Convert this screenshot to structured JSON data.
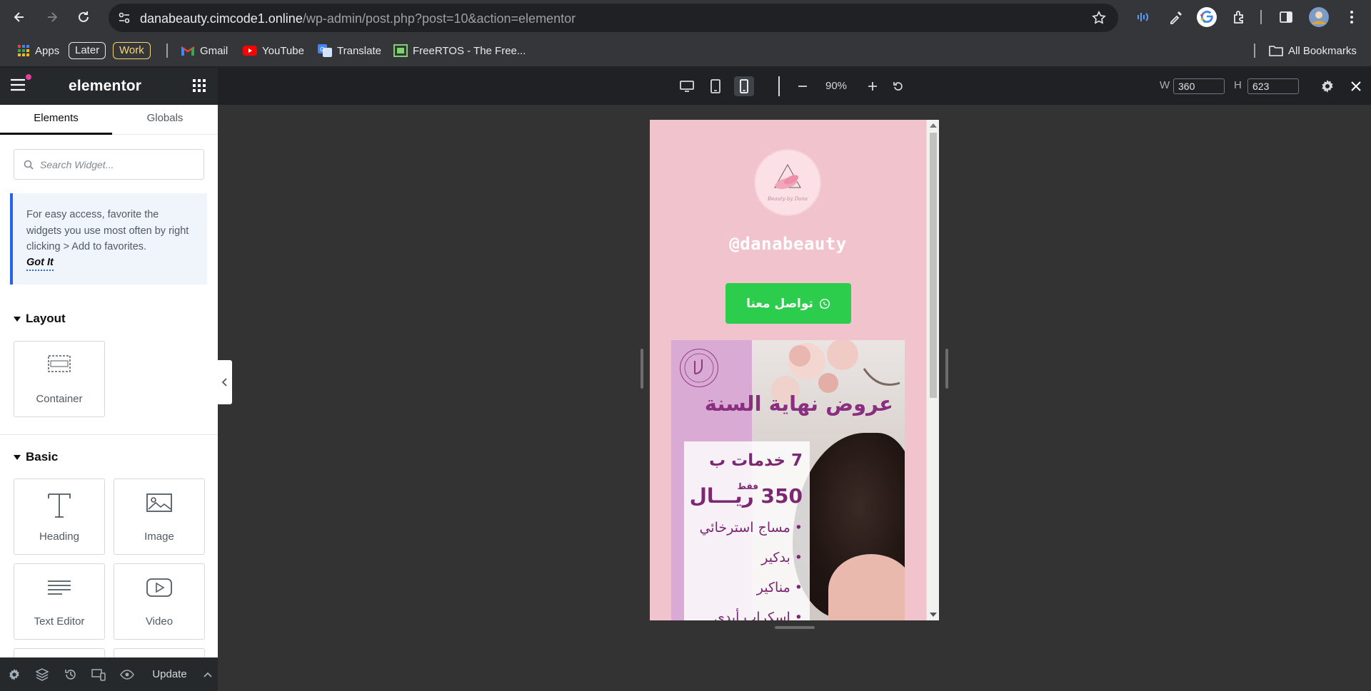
{
  "browser": {
    "url_host": "danabeauty.cimcode1.online",
    "url_path": "/wp-admin/post.php?post=10&action=elementor",
    "bookmarks": {
      "apps": "Apps",
      "later": "Later",
      "work": "Work",
      "gmail": "Gmail",
      "youtube": "YouTube",
      "translate": "Translate",
      "freertos": "FreeRTOS - The Free...",
      "all_bookmarks": "All Bookmarks"
    }
  },
  "editor": {
    "logo": "elementor",
    "zoom": "90%",
    "width_label": "W",
    "width_value": "360",
    "height_label": "H",
    "height_value": "623"
  },
  "panel": {
    "tabs": [
      "Elements",
      "Globals"
    ],
    "search_placeholder": "Search Widget...",
    "notice_text": "For easy access, favorite the widgets you use most often by right clicking > Add to favorites.",
    "notice_link": "Got It",
    "sections": {
      "layout": "Layout",
      "basic": "Basic"
    },
    "layout_widgets": [
      "Container"
    ],
    "basic_widgets": [
      "Heading",
      "Image",
      "Text Editor",
      "Video"
    ],
    "footer_update": "Update"
  },
  "preview": {
    "avatar_sig": "Beauty by Dana",
    "handle": "@danabeauty",
    "button_label": "تواصل معنا",
    "promo_title": "عروض نهاية السنة",
    "promo_line1": "7 خدمات ب",
    "promo_price": "350 ريـــال",
    "promo_only": "فقط",
    "services": [
      "• مساج استرخائي",
      "• بدكير",
      "• مناكير",
      "• اسكراب أيدي"
    ]
  },
  "colors": {
    "accent_pink": "#e53f9b",
    "preview_bg": "#f1c3cc",
    "whatsapp_green": "#2ccd4c",
    "promo_purple": "#8a2f80",
    "notice_border": "#2563eb"
  }
}
